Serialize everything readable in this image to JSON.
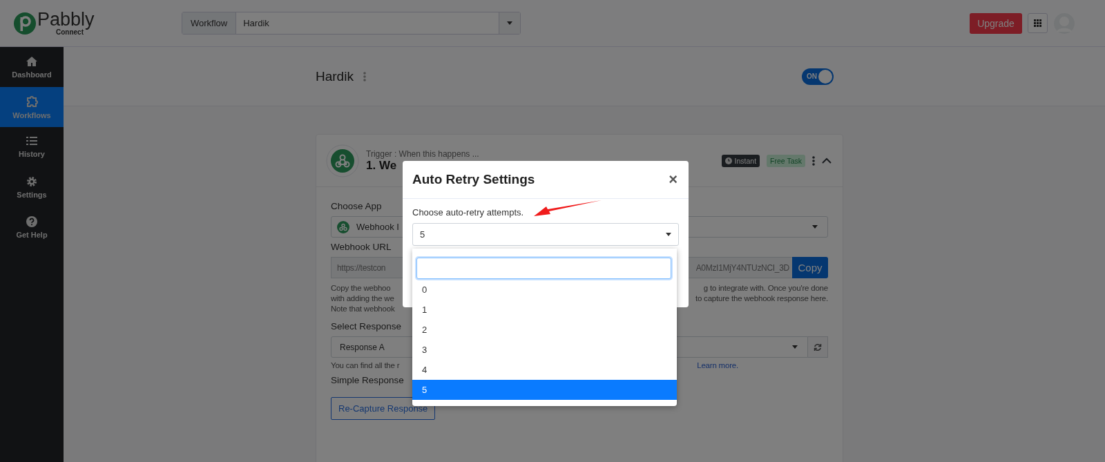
{
  "header": {
    "logo": {
      "name": "Pabbly",
      "sub": "Connect"
    },
    "workflow_label": "Workflow",
    "workflow_value": "Hardik",
    "upgrade": "Upgrade"
  },
  "sidebar": {
    "items": [
      {
        "label": "Dashboard",
        "kind": "home",
        "selected": false
      },
      {
        "label": "Workflows",
        "kind": "puzzle",
        "selected": true
      },
      {
        "label": "History",
        "kind": "list",
        "selected": false
      },
      {
        "label": "Settings",
        "kind": "gear",
        "selected": false
      },
      {
        "label": "Get Help",
        "kind": "help",
        "selected": false
      }
    ]
  },
  "workflow": {
    "title": "Hardik",
    "on": true,
    "toggle_label": "ON"
  },
  "trigger_card": {
    "subtitle": "Trigger : When this happens ...",
    "title": "1. We",
    "badges": [
      {
        "label": "Instant",
        "kind": "instant"
      },
      {
        "label": "Free Task",
        "kind": "free"
      }
    ],
    "choose_app_label": "Choose App",
    "app_value": "Webhook I",
    "url_label": "Webhook URL",
    "url_start": "https://testcon",
    "url_end": "A0MzI1MjY4NTUzNCI_3D",
    "copy": "Copy",
    "description_lines": [
      {
        "left": "Copy the webhoo",
        "right": "g to integrate with. Once you're done"
      },
      {
        "left": "with adding the we",
        "right": "to capture the webhook response here."
      },
      {
        "left": "Note that webhook"
      }
    ],
    "response_label": "Select Response",
    "response_value": "Response A",
    "hint_start": "You can find all the r",
    "hint_link": "Learn more.",
    "simple_label": "Simple Response",
    "recapture": "Re-Capture Response"
  },
  "modal": {
    "title": "Auto Retry Settings",
    "close": "×",
    "label": "Choose auto-retry attempts.",
    "value": "5",
    "options": [
      {
        "label": "0",
        "selected": false
      },
      {
        "label": "1",
        "selected": false
      },
      {
        "label": "2",
        "selected": false
      },
      {
        "label": "3",
        "selected": false
      },
      {
        "label": "4",
        "selected": false
      },
      {
        "label": "5",
        "selected": true
      }
    ]
  }
}
